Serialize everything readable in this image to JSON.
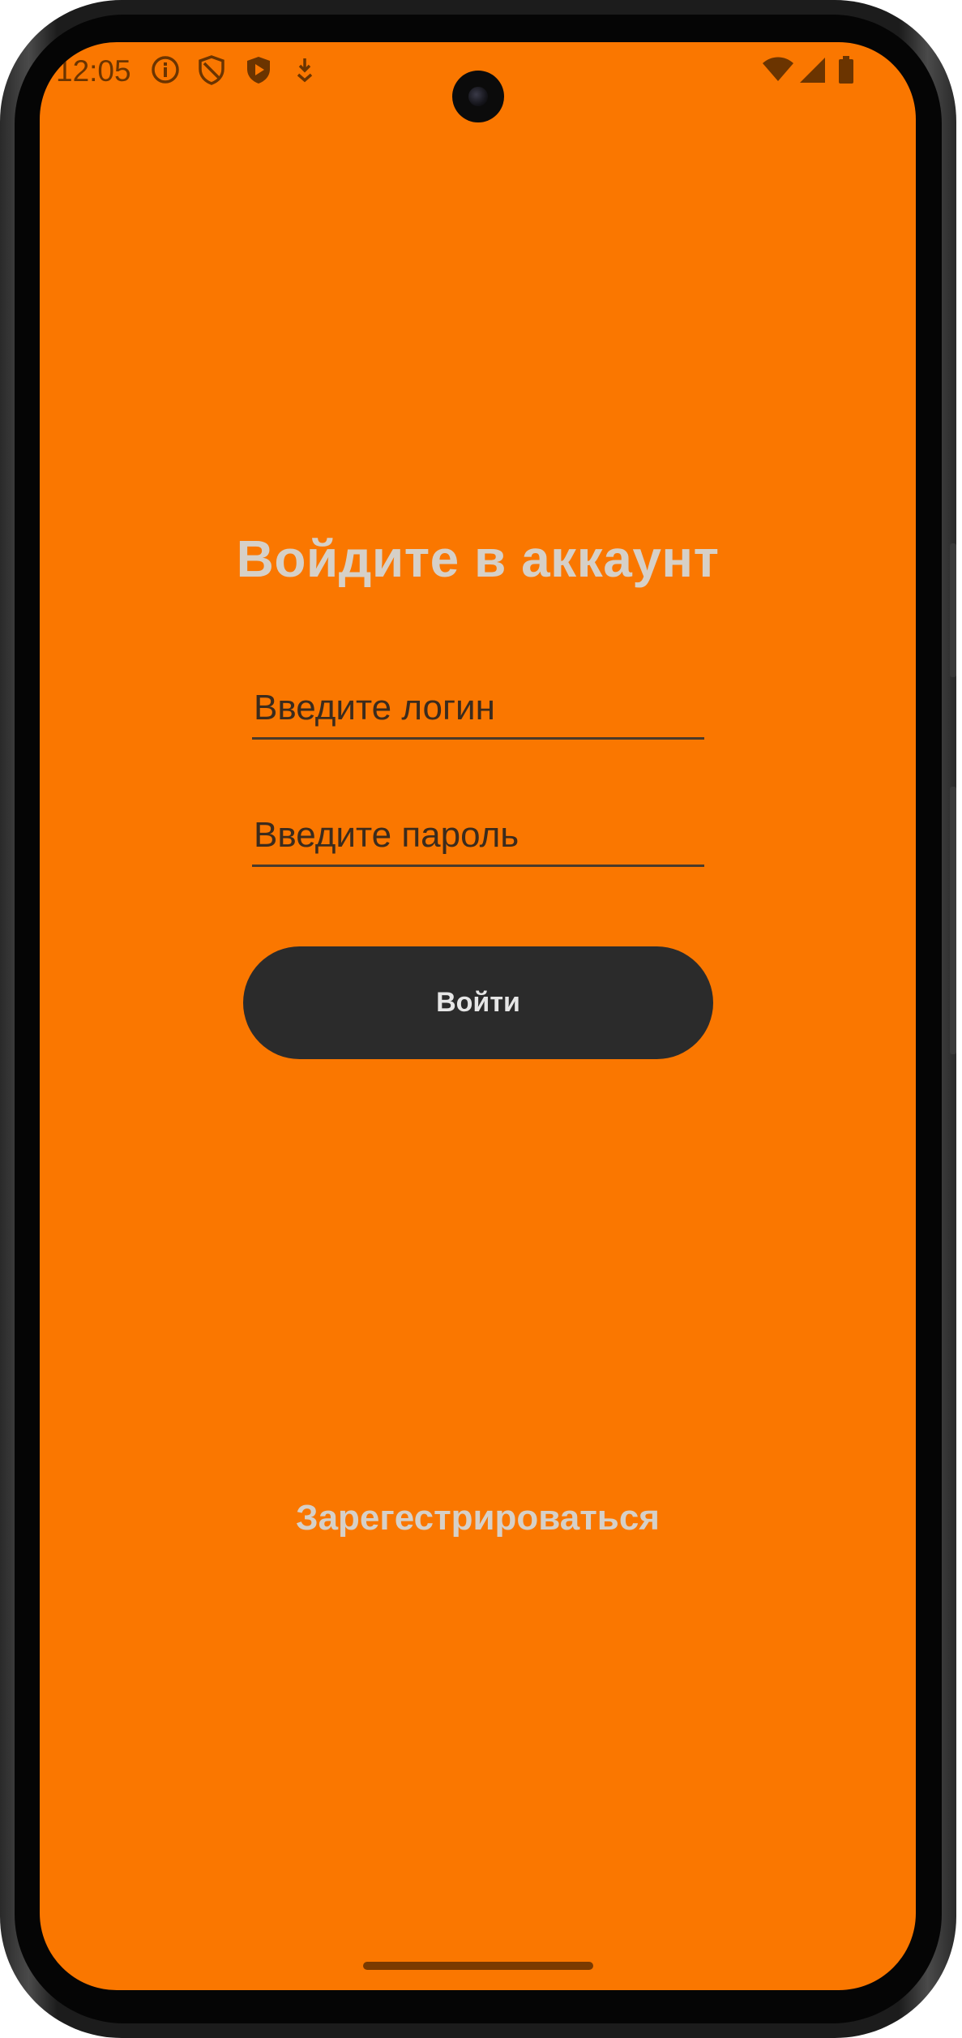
{
  "colors": {
    "screen_bg": "#FA7700",
    "status_fg": "#6b3400",
    "title_fg": "#D6D0C8",
    "input_text": "#3b2b1d",
    "button_bg": "#2B2B2B",
    "button_fg": "#E6E6E6",
    "link_fg": "#D6D0C8",
    "home_indicator": "#7a3a00"
  },
  "status_bar": {
    "time": "12:05",
    "left_icons": [
      "info-icon",
      "shield-icon",
      "play-shield-icon",
      "download-icon"
    ],
    "right_icons": [
      "wifi-icon",
      "cellular-signal-icon",
      "battery-icon"
    ]
  },
  "login": {
    "title": "Войдите в аккаунт",
    "login_field": {
      "placeholder": "Введите логин",
      "value": ""
    },
    "password_field": {
      "placeholder": "Введите пароль",
      "value": ""
    },
    "submit_label": "Войти",
    "register_link": "Зарегестрироваться"
  }
}
